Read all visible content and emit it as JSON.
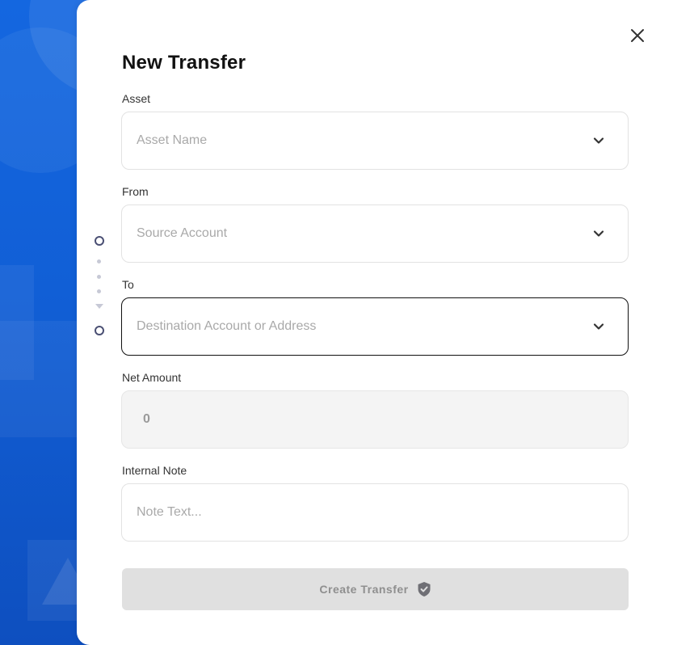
{
  "modal": {
    "title": "New Transfer",
    "close_icon": "close-icon"
  },
  "fields": {
    "asset": {
      "label": "Asset",
      "placeholder": "Asset Name",
      "icon": "chevron-down-icon"
    },
    "from": {
      "label": "From",
      "placeholder": "Source Account",
      "icon": "chevron-down-icon"
    },
    "to": {
      "label": "To",
      "placeholder": "Destination Account or Address",
      "icon": "chevron-down-icon"
    },
    "net_amount": {
      "label": "Net Amount",
      "value": "0"
    },
    "internal_note": {
      "label": "Internal Note",
      "placeholder": "Note Text..."
    }
  },
  "submit": {
    "label": "Create Transfer",
    "icon": "shield-check-icon"
  },
  "colors": {
    "accent_blue": "#1467e0",
    "stepper": "#4a4f73",
    "button_bg": "#e0e0e0"
  }
}
